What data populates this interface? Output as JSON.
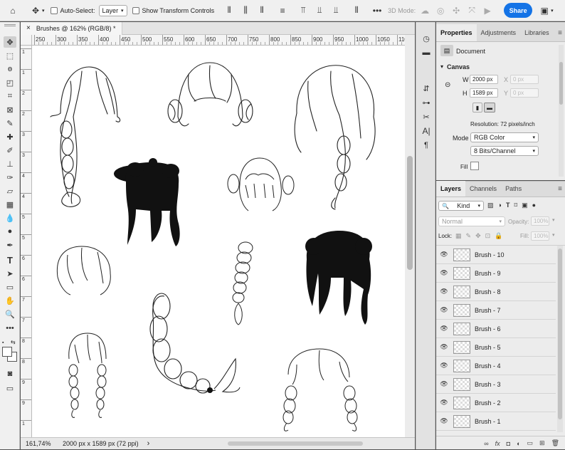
{
  "options_bar": {
    "auto_select_label": "Auto-Select:",
    "layer_select": "Layer",
    "show_transform_label": "Show Transform Controls",
    "mode_3d_label": "3D Mode:",
    "share_label": "Share"
  },
  "document": {
    "tab_title": "Brushes @ 162% (RGB/8) *",
    "close_glyph": "×"
  },
  "rulers": {
    "horizontal": [
      "250",
      "300",
      "350",
      "400",
      "450",
      "500",
      "550",
      "600",
      "650",
      "700",
      "750",
      "800",
      "850",
      "900",
      "950",
      "1000",
      "1050",
      "110"
    ],
    "vertical": [
      "1",
      "1",
      "2",
      "2",
      "3",
      "3",
      "4",
      "4",
      "5",
      "5",
      "6",
      "6",
      "7",
      "7",
      "8",
      "8",
      "9",
      "9",
      "1",
      "1"
    ]
  },
  "status": {
    "zoom": "161,74%",
    "doc_size": "2000 px x 1589 px (72 ppi)",
    "arrow": "›"
  },
  "properties": {
    "tabs": [
      "Properties",
      "Adjustments",
      "Libraries"
    ],
    "doc_label": "Document",
    "section_canvas": "Canvas",
    "w_label": "W",
    "w_value": "2000 px",
    "h_label": "H",
    "h_value": "1589 px",
    "x_label": "X",
    "x_value": "0 px",
    "y_label": "Y",
    "y_value": "0 px",
    "resolution": "Resolution: 72 pixels/inch",
    "mode_label": "Mode",
    "mode_value": "RGB Color",
    "depth_value": "8 Bits/Channel",
    "fill_label": "Fill"
  },
  "layers_panel": {
    "tabs": [
      "Layers",
      "Channels",
      "Paths"
    ],
    "kind_label": "Kind",
    "blend_mode": "Normal",
    "opacity_label": "Opacity:",
    "opacity_value": "100%",
    "lock_label": "Lock:",
    "fill_label": "Fill:",
    "fill_value": "100%",
    "items": [
      "Brush - 10",
      "Brush - 9",
      "Brush - 8",
      "Brush - 7",
      "Brush - 6",
      "Brush - 5",
      "Brush - 4",
      "Brush - 3",
      "Brush - 2",
      "Brush - 1"
    ],
    "footer_fx": "fx"
  },
  "icons": [
    "home-icon",
    "move-icon",
    "marquee-icon",
    "lasso-icon",
    "crop-icon",
    "eyedropper-icon",
    "brush-icon",
    "eraser-icon",
    "pen-icon",
    "type-icon",
    "hand-icon",
    "zoom-icon",
    "eye-icon",
    "lock-icon",
    "trash-icon"
  ],
  "colors": {
    "accent": "#1473e6",
    "panel": "#ececec",
    "canvas": "#ffffff"
  }
}
